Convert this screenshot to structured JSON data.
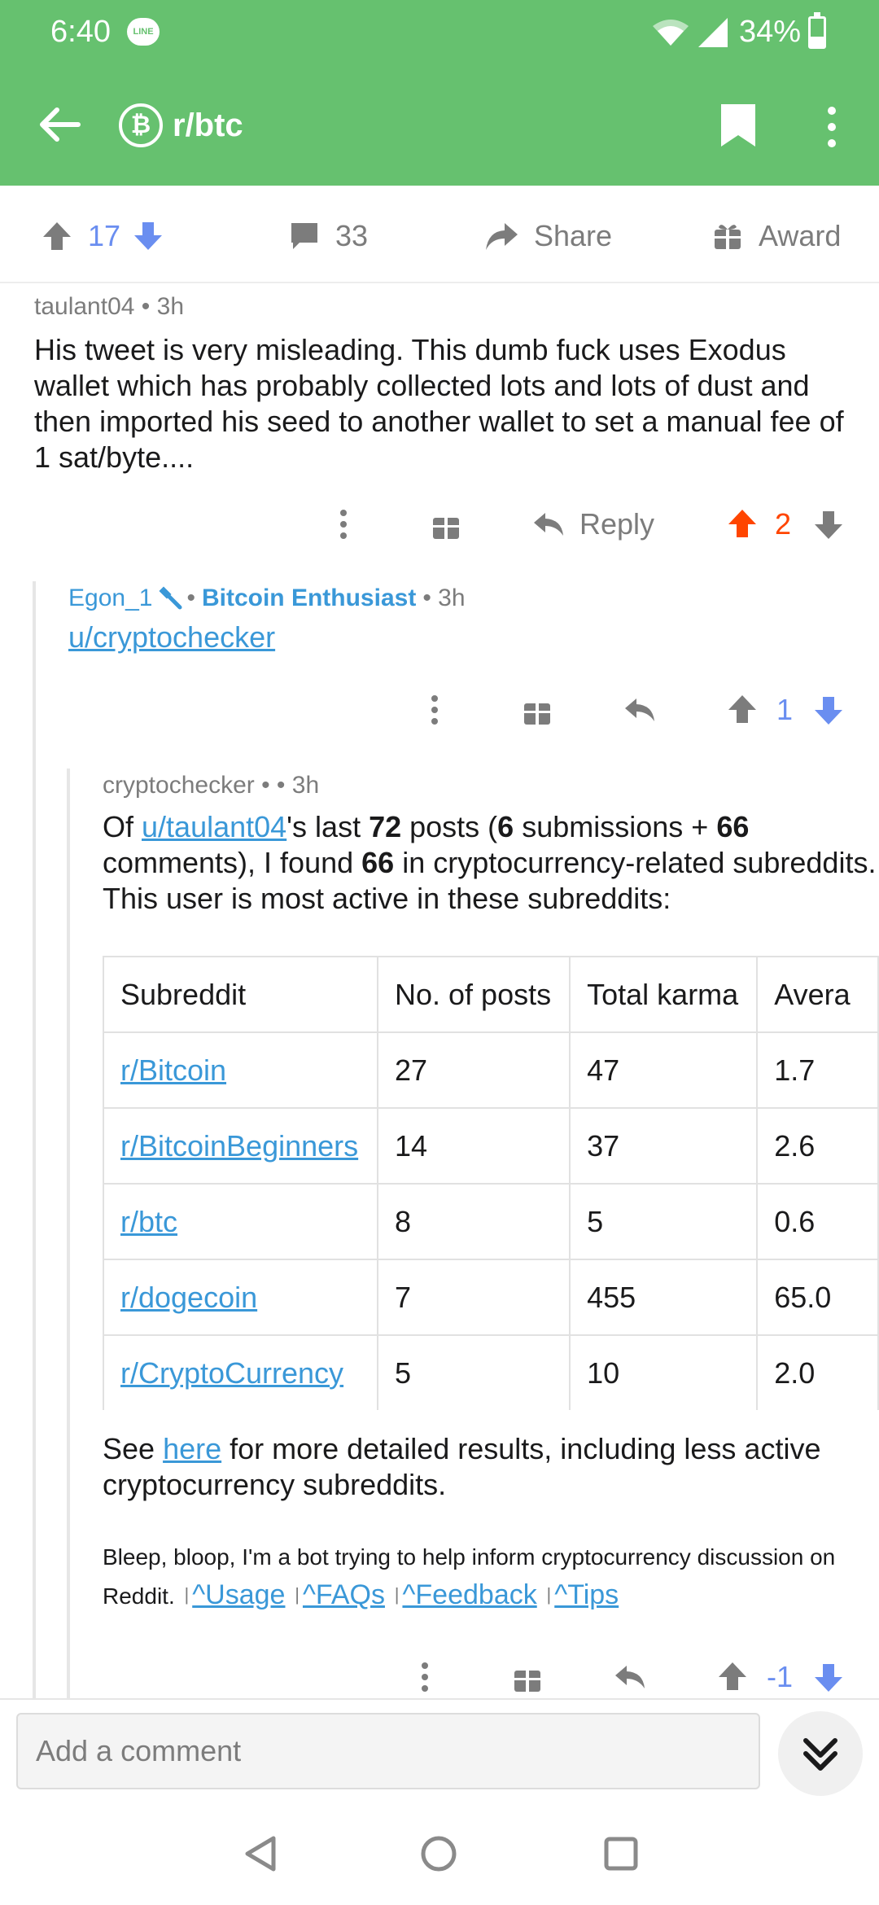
{
  "status_bar": {
    "time": "6:40",
    "line_badge": "LINE",
    "battery": "34%",
    "battery_level": 0.34
  },
  "header": {
    "subreddit": "r/btc",
    "logo_glyph": "₿"
  },
  "post_actions": {
    "score": "17",
    "comments": "33",
    "share": "Share",
    "award": "Award"
  },
  "comment1": {
    "author": "taulant04",
    "time": "• 3h",
    "body": "His tweet is very misleading. This dumb fuck uses Exodus wallet which has probably collected lots and lots of dust and then imported his seed to another wallet to set a manual fee of 1 sat/byte....",
    "reply": "Reply",
    "score": "2"
  },
  "comment2": {
    "author": "Egon_1",
    "dot": "•",
    "flair": "Bitcoin Enthusiast",
    "time": "• 3h",
    "link": "u/cryptochecker",
    "score": "1"
  },
  "comment3": {
    "author": "cryptochecker",
    "time": "•  • 3h",
    "p_of": "Of ",
    "p_user": "u/taulant04",
    "p_last": "'s last ",
    "p_72": "72",
    "p_posts": " posts (",
    "p_6": "6",
    "p_sub": " submissions + ",
    "p_66": "66",
    "p_comm": " comments), I found ",
    "p_66b": "66",
    "p_rest": " in cryptocurrency-related subreddits. This user is most active in these subreddits:",
    "see": "See ",
    "here": "here",
    "see_rest": " for more detailed results, including less active cryptocurrency subreddits.",
    "bot_text": "Bleep, bloop, I'm a bot trying to help inform cryptocurrency discussion on Reddit.",
    "bot_sep": "|",
    "bot_links": [
      "^Usage",
      "^FAQs",
      "^Feedback",
      "^Tips"
    ],
    "score": "-1"
  },
  "table": {
    "headers": [
      "Subreddit",
      "No. of posts",
      "Total karma",
      "Avera"
    ],
    "rows": [
      [
        "r/Bitcoin",
        "27",
        "47",
        "1.7"
      ],
      [
        "r/BitcoinBeginners",
        "14",
        "37",
        "2.6"
      ],
      [
        "r/btc",
        "8",
        "5",
        "0.6"
      ],
      [
        "r/dogecoin",
        "7",
        "455",
        "65.0"
      ],
      [
        "r/CryptoCurrency",
        "5",
        "10",
        "2.0"
      ]
    ]
  },
  "comment_bar": {
    "placeholder": "Add a comment"
  },
  "colors": {
    "header_green": "#66c16f",
    "upvote_blue": "#6a8ef0",
    "upvote_orange": "#ff4500",
    "link_blue": "#3a98d8"
  }
}
